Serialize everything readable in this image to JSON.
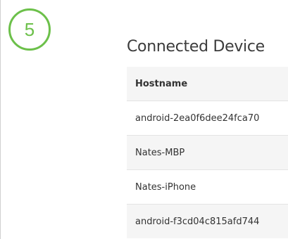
{
  "step": {
    "number": "5",
    "color": "#6cc04a"
  },
  "section": {
    "title": "Connected Device"
  },
  "table": {
    "columns": [
      "Hostname"
    ],
    "rows": [
      "android-2ea0f6dee24fca70",
      "Nates-MBP",
      "Nates-iPhone",
      "android-f3cd04c815afd744"
    ]
  }
}
